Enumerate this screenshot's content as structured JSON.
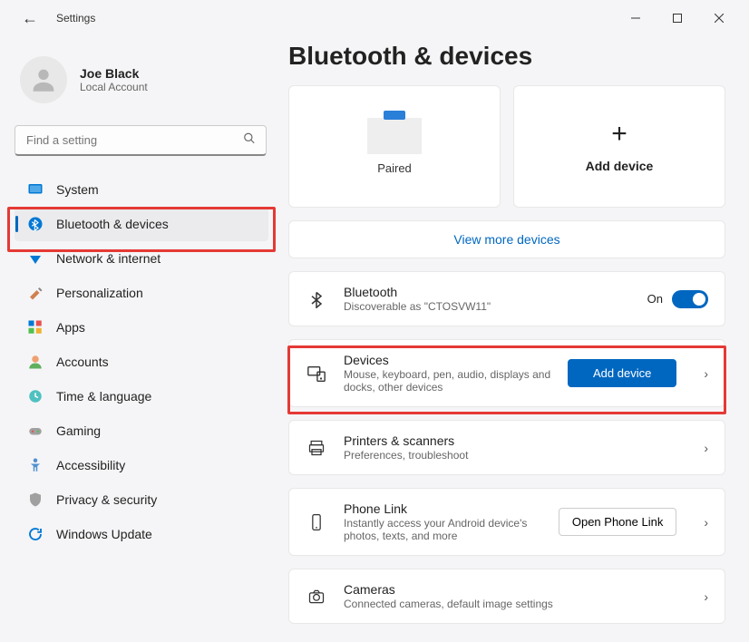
{
  "window": {
    "title": "Settings"
  },
  "user": {
    "name": "Joe Black",
    "account_type": "Local Account"
  },
  "search": {
    "placeholder": "Find a setting"
  },
  "sidebar": {
    "items": [
      {
        "label": "System"
      },
      {
        "label": "Bluetooth & devices"
      },
      {
        "label": "Network & internet"
      },
      {
        "label": "Personalization"
      },
      {
        "label": "Apps"
      },
      {
        "label": "Accounts"
      },
      {
        "label": "Time & language"
      },
      {
        "label": "Gaming"
      },
      {
        "label": "Accessibility"
      },
      {
        "label": "Privacy & security"
      },
      {
        "label": "Windows Update"
      }
    ]
  },
  "page": {
    "title": "Bluetooth & devices",
    "paired_label": "Paired",
    "add_device_label": "Add device",
    "view_more": "View more devices",
    "bluetooth": {
      "title": "Bluetooth",
      "desc": "Discoverable as \"CTOSVW11\"",
      "state": "On"
    },
    "devices": {
      "title": "Devices",
      "desc": "Mouse, keyboard, pen, audio, displays and docks, other devices",
      "button": "Add device"
    },
    "printers": {
      "title": "Printers & scanners",
      "desc": "Preferences, troubleshoot"
    },
    "phone": {
      "title": "Phone Link",
      "desc": "Instantly access your Android device's photos, texts, and more",
      "button": "Open Phone Link"
    },
    "cameras": {
      "title": "Cameras",
      "desc": "Connected cameras, default image settings"
    }
  }
}
